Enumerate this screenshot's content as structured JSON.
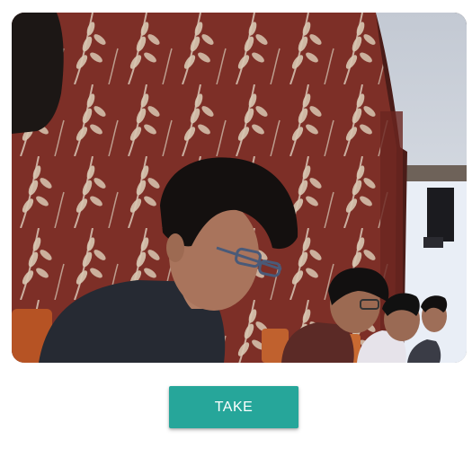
{
  "camera": {
    "feed_label": "webcam-preview"
  },
  "actions": {
    "take_label": "TAKE"
  },
  "colors": {
    "button_bg": "#26a69a",
    "button_text": "#ffffff"
  }
}
